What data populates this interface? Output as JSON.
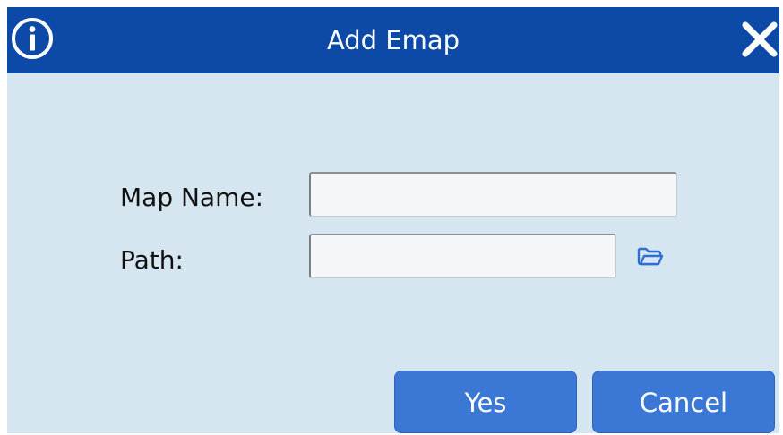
{
  "dialog": {
    "title": "Add Emap",
    "info_icon": "info-icon",
    "close_icon": "close-icon",
    "colors": {
      "titlebar": "#0d4aa8",
      "body": "#d6e6f0",
      "button": "#3b78d6"
    }
  },
  "form": {
    "map_name_label": "Map Name:",
    "map_name_value": "",
    "path_label": "Path:",
    "path_value": "",
    "browse_icon": "folder-open-icon"
  },
  "buttons": {
    "yes_label": "Yes",
    "cancel_label": "Cancel"
  }
}
